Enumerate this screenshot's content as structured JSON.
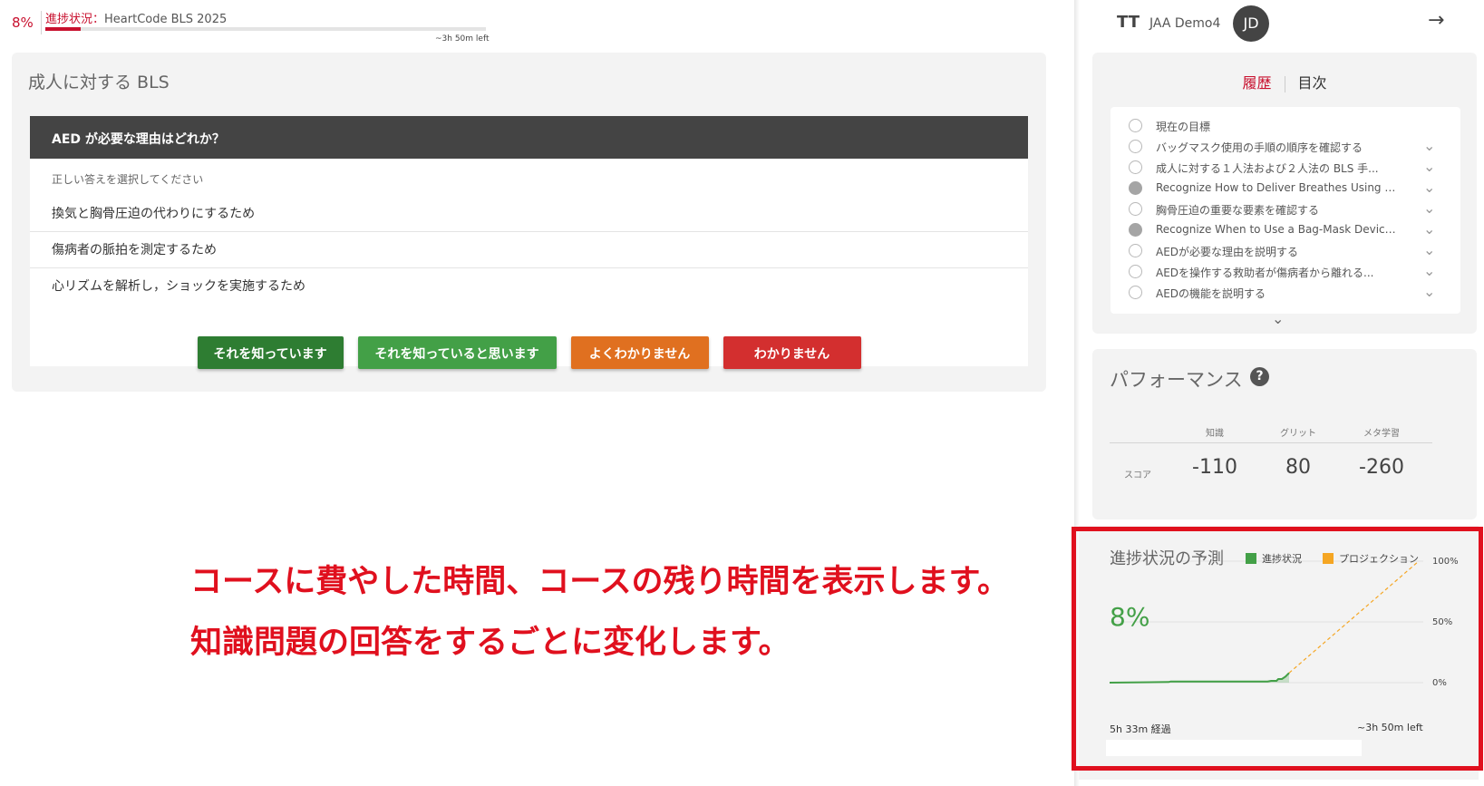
{
  "progress": {
    "percent_text": "8%",
    "label": "進捗状況：",
    "course": "HeartCode BLS 2025",
    "fraction": 0.08,
    "time_left": "~3h 50m left"
  },
  "question": {
    "section_title": "成人に対する BLS",
    "prompt": "AED が必要な理由はどれか？",
    "instruction": "正しい答えを選択してください",
    "options": [
      "換気と胸骨圧迫の代わりにするため",
      "傷病者の脈拍を測定するため",
      "心リズムを解析し，ショックを実施するため"
    ],
    "buttons": [
      "それを知っています",
      "それを知っていると思います",
      "よくわかりません",
      "わかりません"
    ],
    "button_colors": [
      "#2e7d32",
      "#43a047",
      "#e07020",
      "#d32f2f"
    ]
  },
  "header": {
    "text_size_icon": "text-size-icon",
    "text_size_glyph": "TT",
    "username": "JAA Demo4",
    "avatar_initials": "JD",
    "exit_icon": "arrow-right-icon",
    "exit_glyph": "→"
  },
  "history": {
    "tabs": [
      "履歴",
      "目次"
    ],
    "active_tab": "履歴",
    "items": [
      {
        "label": "現在の目標",
        "completed": false,
        "expandable": false
      },
      {
        "label": "バッグマスク使用の手順の順序を確認する",
        "completed": false,
        "expandable": true
      },
      {
        "label": "成人に対する１人法および２人法の BLS 手...",
        "completed": false,
        "expandable": true
      },
      {
        "label": "Recognize How to Deliver Breathes Using a B...",
        "completed": true,
        "expandable": true
      },
      {
        "label": "胸骨圧迫の重要な要素を確認する",
        "completed": false,
        "expandable": true
      },
      {
        "label": "Recognize When to Use a Bag-Mask Device t...",
        "completed": true,
        "expandable": true
      },
      {
        "label": "AEDが必要な理由を説明する",
        "completed": false,
        "expandable": true
      },
      {
        "label": "AEDを操作する救助者が傷病者から離れる...",
        "completed": false,
        "expandable": true
      },
      {
        "label": "AEDの機能を説明する",
        "completed": false,
        "expandable": true
      }
    ],
    "chevron_glyph": "⌄",
    "show_more_glyph": "⌄"
  },
  "performance": {
    "title": "パフォーマンス",
    "help_glyph": "?",
    "columns": [
      "知識",
      "グリット",
      "メタ学習"
    ],
    "row_label": "スコア",
    "values": [
      "-110",
      "80",
      "-260"
    ]
  },
  "forecast": {
    "title": "進捗状況の予測",
    "legend": [
      {
        "name": "進捗状況",
        "color": "#43a047"
      },
      {
        "name": "プロジェクション",
        "color": "#f5a623"
      }
    ],
    "current_percent": "8%",
    "y_ticks": [
      "100%",
      "50%",
      "0%"
    ],
    "elapsed_label": "5h 33m 経過",
    "remaining_label": "~3h 50m  left"
  },
  "chart_data": {
    "type": "line",
    "title": "進捗状況の予測",
    "xlabel": "",
    "ylabel": "",
    "ylim": [
      0,
      100
    ],
    "x_tick_labels": [
      "5h 33m 経過",
      "~3h 50m  left"
    ],
    "y_tick_labels": [
      "100%",
      "50%",
      "0%"
    ],
    "series": [
      {
        "name": "進捗状況",
        "x": [
          0,
          0.33,
          0.34,
          0.88,
          0.9,
          0.93,
          0.94,
          0.96,
          0.98,
          1.0
        ],
        "y": [
          0,
          0.5,
          1,
          1,
          1.5,
          1.5,
          3,
          3,
          5,
          8
        ],
        "color": "#43a047"
      },
      {
        "name": "プロジェクション",
        "x": [
          1.0,
          2.0
        ],
        "y": [
          8,
          100
        ],
        "color": "#f5a623",
        "dashed": true
      }
    ]
  },
  "annotations": [
    "コースに費やした時間、コースの残り時間を表示します。",
    "知識問題の回答をするごとに変化します。"
  ]
}
